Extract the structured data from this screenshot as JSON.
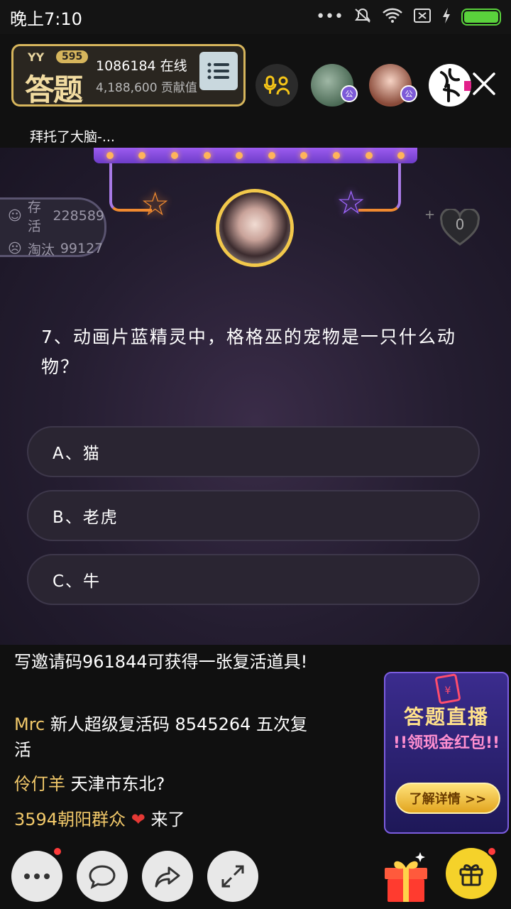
{
  "status_bar": {
    "time": "晚上7:10"
  },
  "header": {
    "logo": {
      "brand": "YY",
      "badge": "595",
      "title": "答题"
    },
    "online_count": "1086184 在线",
    "contribution": "4,188,600 贡献值",
    "subtitle": "拜托了大脑-...",
    "avatar_badge": "公"
  },
  "stage": {
    "survive_label": "存活",
    "survive_value": "228589",
    "eliminated_label": "淘汰",
    "eliminated_value": "99127",
    "likes": "0"
  },
  "quiz": {
    "question": "7、动画片蓝精灵中，格格巫的宠物是一只什么动物？",
    "options": [
      "A、猫",
      "B、老虎",
      "C、牛"
    ]
  },
  "chat": {
    "messages": [
      {
        "nick": "",
        "text": "写邀请码961844可获得一张复活道具!"
      },
      {
        "nick": "Mrc",
        "text": " 新人超级复活码 8545264  五次复活"
      },
      {
        "nick": "伶仃羊",
        "text": " 天津市东北?"
      },
      {
        "nick": "3594朝阳群众",
        "text": "来了"
      }
    ]
  },
  "promo": {
    "title": "答题直播",
    "subtitle": "!!领现金红包!!",
    "button": "了解详情 >>",
    "envelope": "¥"
  },
  "colors": {
    "accent_gold": "#d6b55c",
    "option_bg": "#2a2532",
    "nick": "#f2c96a",
    "timer_ring": "#f2c84b"
  }
}
